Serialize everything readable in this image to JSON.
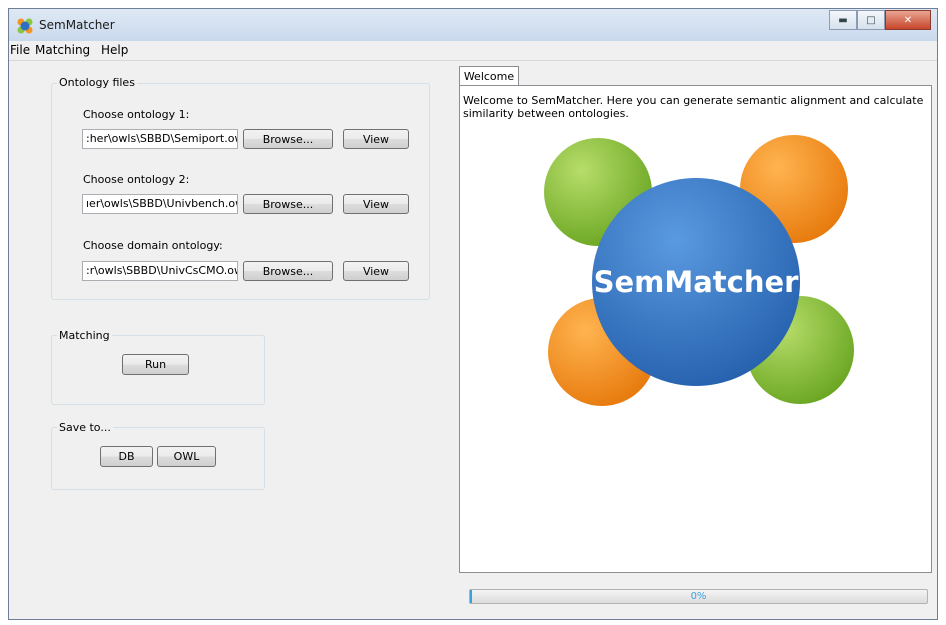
{
  "window": {
    "title": "SemMatcher"
  },
  "menu": {
    "items": [
      "File",
      "Matching",
      "Help"
    ]
  },
  "ontology_files": {
    "group_label": "Ontology files",
    "rows": [
      {
        "label": "Choose ontology 1:",
        "value": ":her\\owls\\SBBD\\Semiport.owl",
        "browse": "Browse...",
        "view": "View"
      },
      {
        "label": "Choose ontology 2:",
        "value": "ıer\\owls\\SBBD\\Univbench.owl",
        "browse": "Browse...",
        "view": "View"
      },
      {
        "label": "Choose domain ontology:",
        "value": ":r\\owls\\SBBD\\UnivCsCMO.owl",
        "browse": "Browse...",
        "view": "View"
      }
    ]
  },
  "matching": {
    "group_label": "Matching",
    "run_label": "Run"
  },
  "save": {
    "group_label": "Save to...",
    "db_label": "DB",
    "owl_label": "OWL"
  },
  "tabs": {
    "welcome_label": "Welcome"
  },
  "welcome": {
    "text": "Welcome to SemMatcher. Here you can generate semantic alignment and calculate similarity between ontologies.",
    "logo_text": "SemMatcher"
  },
  "progress": {
    "value": 0.0,
    "text": "0%"
  },
  "colors": {
    "green": "#8cc63f",
    "orange": "#f7941d",
    "blue": "#2d6fc0",
    "progress": "#3c9fe0"
  },
  "icons": {
    "app": "semmatcher-app-icon",
    "minimize": "minimize-icon",
    "maximize": "maximize-icon",
    "close": "close-icon"
  }
}
